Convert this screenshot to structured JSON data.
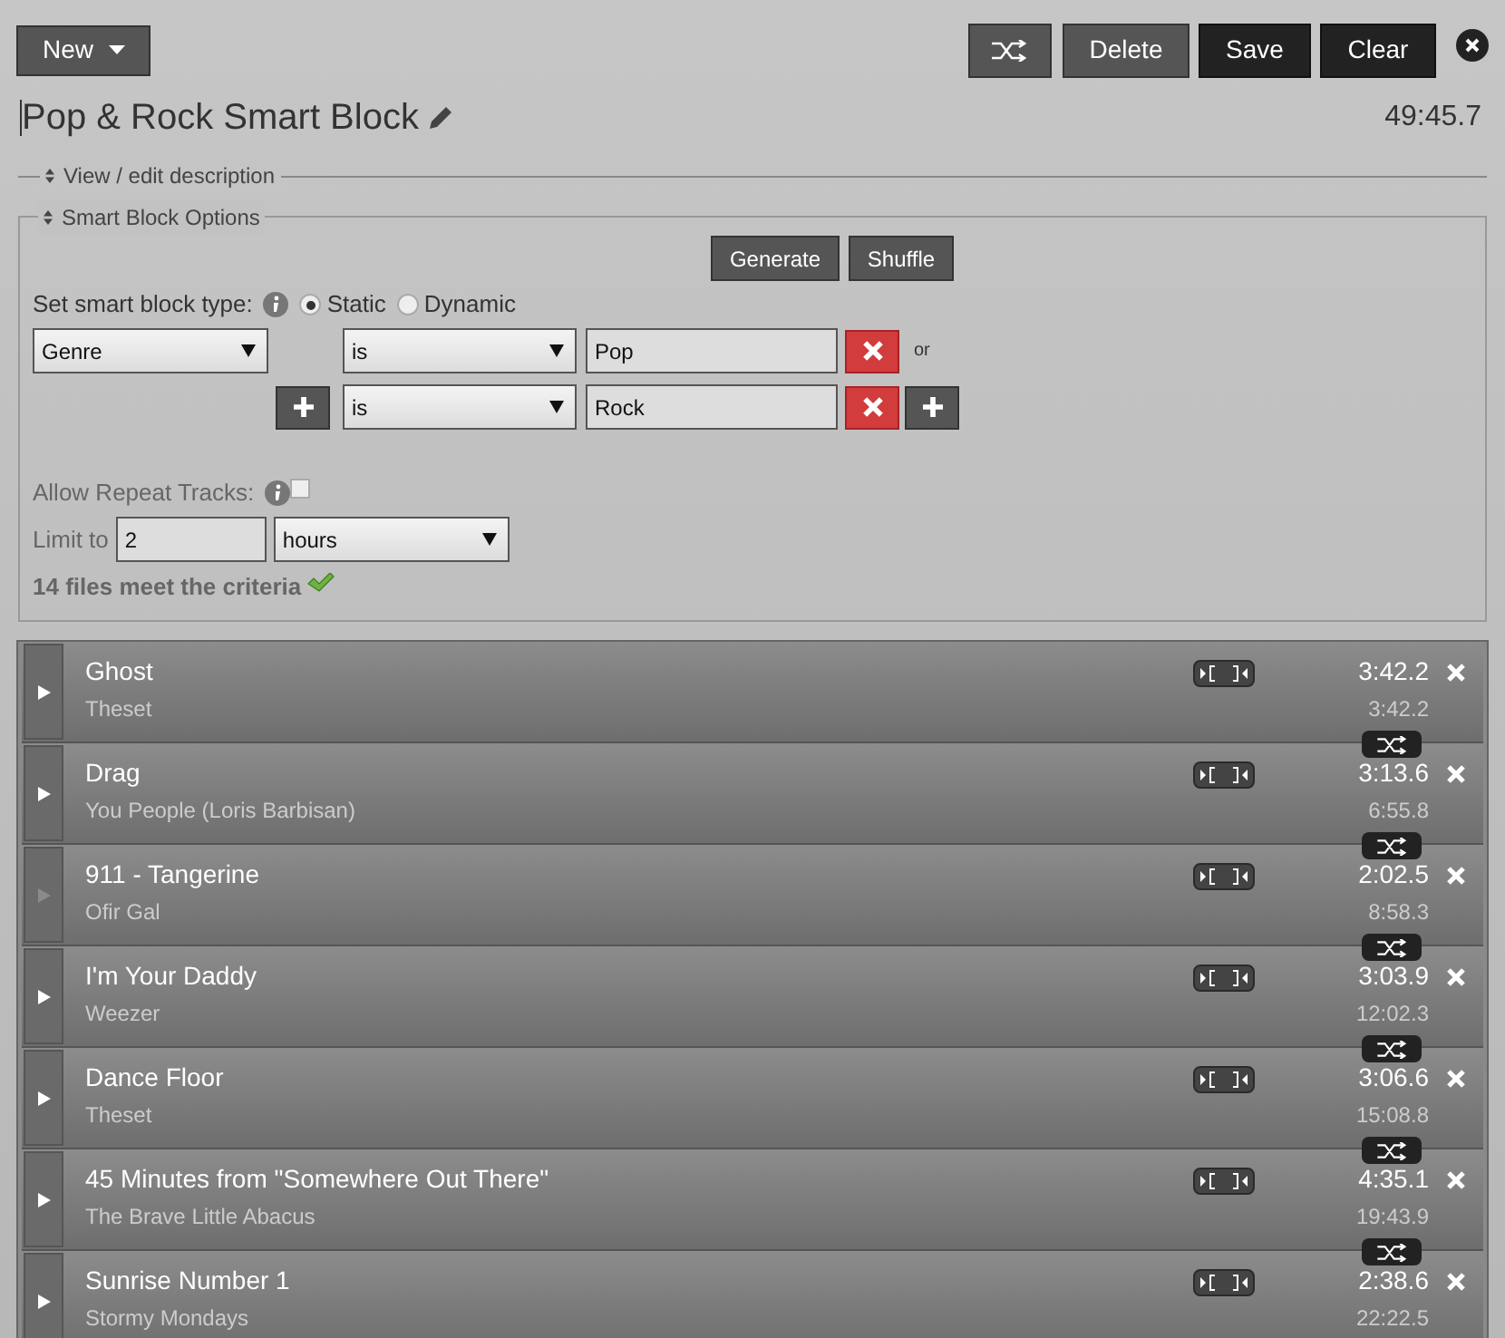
{
  "toolbar": {
    "new": "New",
    "delete": "Delete",
    "save": "Save",
    "clear": "Clear"
  },
  "title": "Pop & Rock Smart Block",
  "total_duration": "49:45.7",
  "description_toggle": "View / edit description",
  "options": {
    "legend": "Smart Block Options",
    "generate": "Generate",
    "shuffle": "Shuffle",
    "type_label": "Set smart block type:",
    "types": [
      {
        "label": "Static",
        "selected": true
      },
      {
        "label": "Dynamic",
        "selected": false
      }
    ],
    "criteria": [
      {
        "field": "Genre",
        "modifier": "is",
        "value": "Pop",
        "connector": "or"
      },
      {
        "modifier": "is",
        "value": "Rock"
      }
    ],
    "repeat": {
      "label": "Allow Repeat Tracks:",
      "checked": false
    },
    "limit": {
      "label": "Limit to",
      "value": "2",
      "unit": "hours"
    },
    "status": "14 files meet the criteria"
  },
  "tracks": [
    {
      "title": "Ghost",
      "artist": "Theset",
      "length": "3:42.2",
      "elapsed": "3:42.2",
      "playable": true
    },
    {
      "title": "Drag",
      "artist": "You People (Loris Barbisan)",
      "length": "3:13.6",
      "elapsed": "6:55.8",
      "playable": true
    },
    {
      "title": "911 - Tangerine",
      "artist": "Ofir Gal",
      "length": "2:02.5",
      "elapsed": "8:58.3",
      "playable": false
    },
    {
      "title": "I'm Your Daddy",
      "artist": "Weezer",
      "length": "3:03.9",
      "elapsed": "12:02.3",
      "playable": true
    },
    {
      "title": "Dance Floor",
      "artist": "Theset",
      "length": "3:06.6",
      "elapsed": "15:08.8",
      "playable": true
    },
    {
      "title": "45 Minutes from \"Somewhere Out There\"",
      "artist": "The Brave Little Abacus",
      "length": "4:35.1",
      "elapsed": "19:43.9",
      "playable": true
    },
    {
      "title": "Sunrise Number 1",
      "artist": "Stormy Mondays",
      "length": "2:38.6",
      "elapsed": "22:22.5",
      "playable": true
    }
  ]
}
